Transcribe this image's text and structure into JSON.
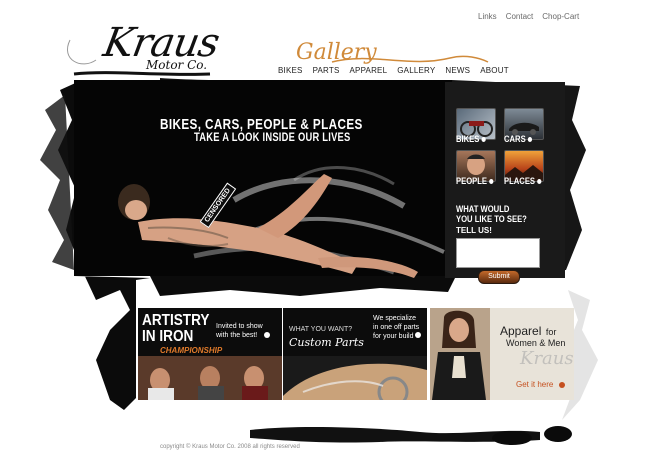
{
  "top_links": [
    "Links",
    "Contact",
    "Chop-Cart"
  ],
  "logo": {
    "main": "Kraus",
    "sub": "Motor Co."
  },
  "section_script": "Gallery",
  "nav": [
    "BIKES",
    "PARTS",
    "APPAREL",
    "GALLERY",
    "NEWS",
    "ABOUT"
  ],
  "hero": {
    "title1": "BIKES, CARS, PEOPLE & PLACES",
    "title2": "TAKE A LOOK INSIDE OUR LIVES",
    "censor_label": "CENSORED"
  },
  "gallery_panel": {
    "tiles": [
      "BIKES",
      "CARS",
      "PEOPLE",
      "PLACES"
    ],
    "question": [
      "WHAT WOULD",
      "YOU LIKE TO SEE?"
    ],
    "tell_us": "TELL US!",
    "submit": "Submit"
  },
  "promos": {
    "artistry": {
      "title1": "ARTISTRY",
      "title2": "IN IRON",
      "sub": "CHAMPIONSHIP",
      "text1": "Invited to show",
      "text2": "with the best!"
    },
    "parts": {
      "question": "WHAT YOU WANT?",
      "script": "Custom Parts",
      "text1": "We specialize",
      "text2": "in one off parts",
      "text3": "for your build"
    },
    "apparel": {
      "title": "Apparel",
      "for": "for",
      "line2": "Women & Men",
      "brand": "Kraus",
      "cta": "Get it here"
    }
  },
  "footer": "copyright © Kraus Motor Co. 2008 all rights reserved",
  "colors": {
    "accent": "#d08a3a",
    "cta": "#c5501f",
    "dark": "#0a0a0a"
  }
}
